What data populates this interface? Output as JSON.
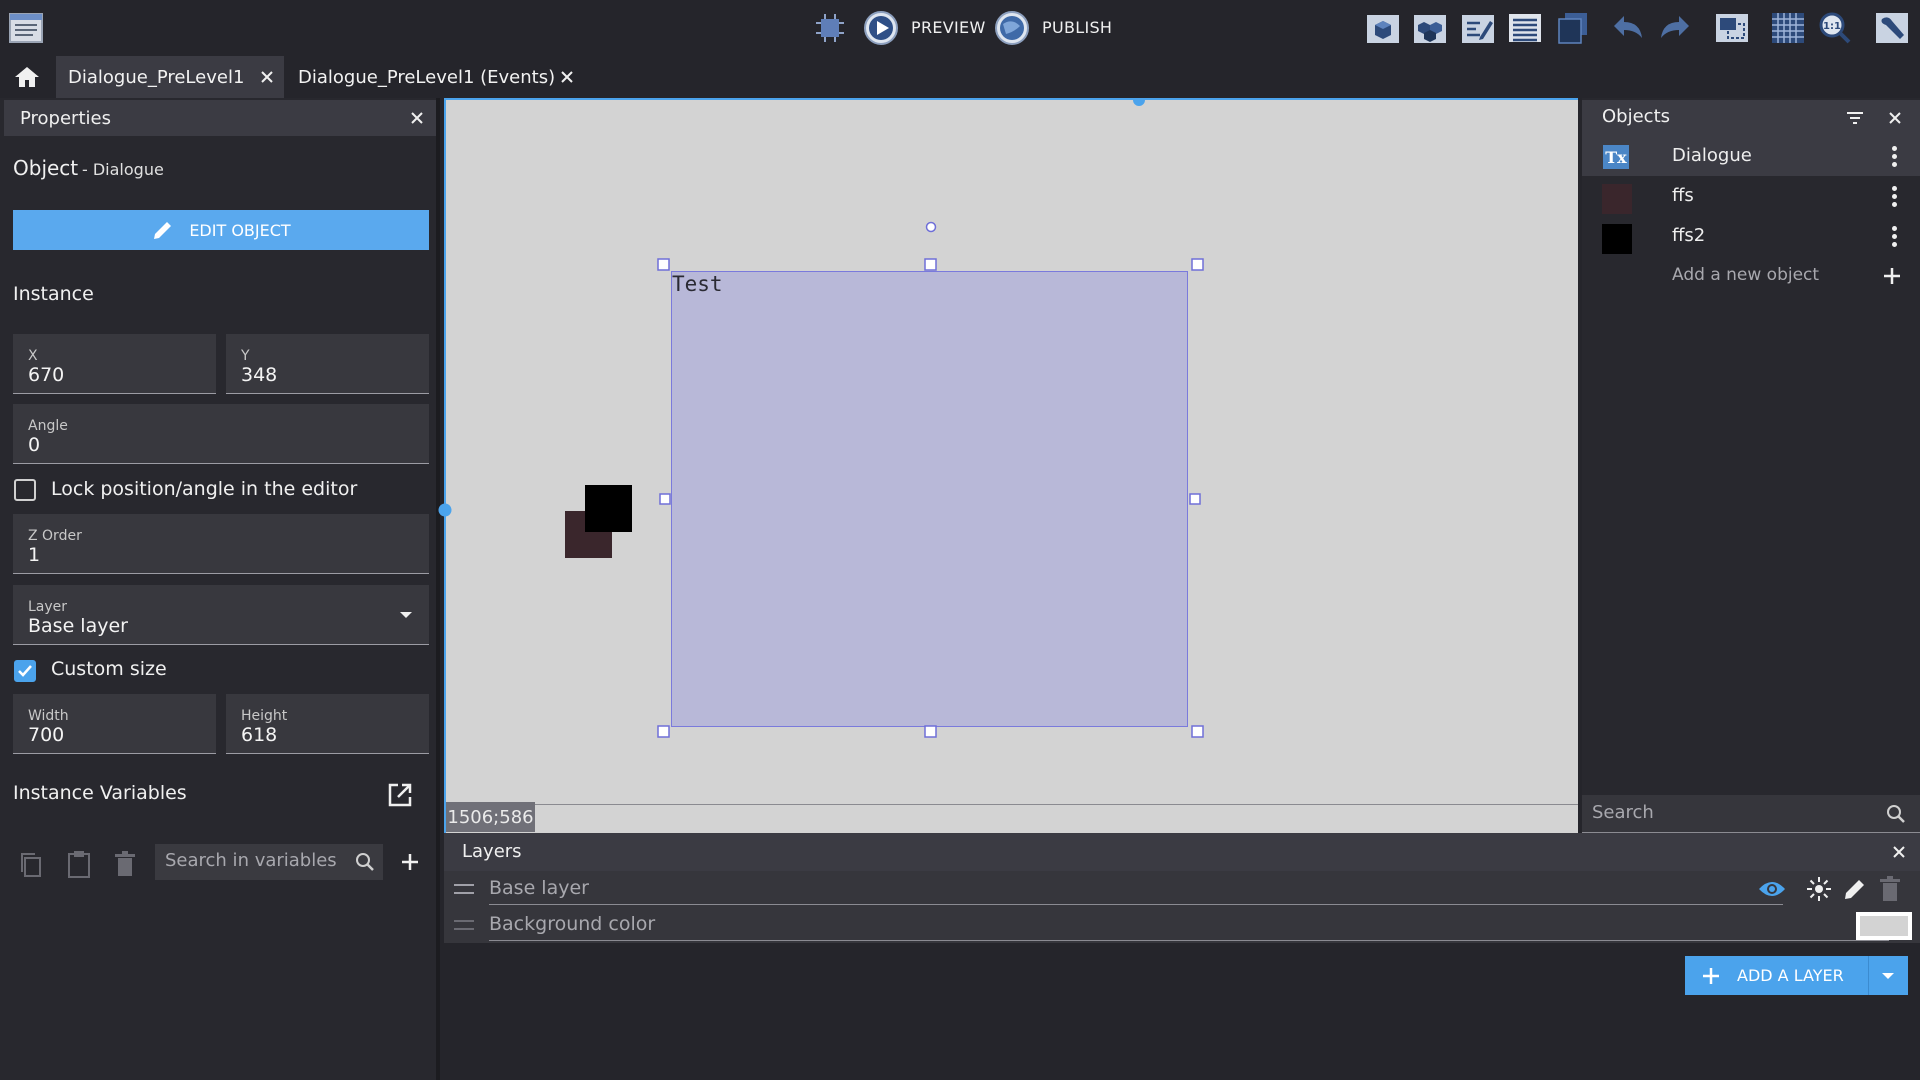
{
  "toolbar": {
    "preview_label": "PREVIEW",
    "publish_label": "PUBLISH",
    "icons": [
      "project-manager-icon",
      "debugger-icon",
      "preview-play-icon",
      "publish-globe-icon",
      "objects-panel-icon",
      "groups-panel-icon",
      "properties-panel-icon",
      "layers-panel-icon",
      "instances-list-icon",
      "undo-icon",
      "redo-icon",
      "window-mask-icon",
      "grid-icon",
      "zoom-icon",
      "settings-wrench-icon"
    ]
  },
  "tabs": {
    "home_icon": "home-icon",
    "items": [
      {
        "label": "Dialogue_PreLevel1",
        "active": true
      },
      {
        "label": "Dialogue_PreLevel1 (Events)",
        "active": false
      }
    ]
  },
  "properties": {
    "title": "Properties",
    "object_label": "Object",
    "object_name": "- Dialogue",
    "edit_button": "EDIT OBJECT",
    "instance_heading": "Instance",
    "x": {
      "label": "X",
      "value": "670"
    },
    "y": {
      "label": "Y",
      "value": "348"
    },
    "angle": {
      "label": "Angle",
      "value": "0"
    },
    "lock_label": "Lock position/angle in the editor",
    "lock_checked": false,
    "zorder": {
      "label": "Z Order",
      "value": "1"
    },
    "layer": {
      "label": "Layer",
      "value": "Base layer"
    },
    "custom_size_label": "Custom size",
    "custom_size_checked": true,
    "width": {
      "label": "Width",
      "value": "700"
    },
    "height": {
      "label": "Height",
      "value": "618"
    },
    "variables_heading": "Instance Variables",
    "search_variables_placeholder": "Search in variables"
  },
  "scene": {
    "dialogue_text": "Test",
    "cursor_coords": "1506;586",
    "dialogue_fill": "#b8b8d8",
    "ffs_color": "#3a262c",
    "ffs2_color": "#000000"
  },
  "objects": {
    "title": "Objects",
    "items": [
      {
        "name": "Dialogue",
        "icon": "text-object-icon",
        "selected": true
      },
      {
        "name": "ffs",
        "icon": "sprite-thumbnail-icon",
        "color": "#3a262c"
      },
      {
        "name": "ffs2",
        "icon": "sprite-thumbnail-icon",
        "color": "#000000"
      }
    ],
    "add_label": "Add a new object",
    "search_placeholder": "Search"
  },
  "layers": {
    "title": "Layers",
    "items": [
      {
        "name": "Base layer"
      },
      {
        "name": "Background color"
      }
    ],
    "add_button": "ADD A LAYER",
    "accent": "#4ba3ec"
  }
}
